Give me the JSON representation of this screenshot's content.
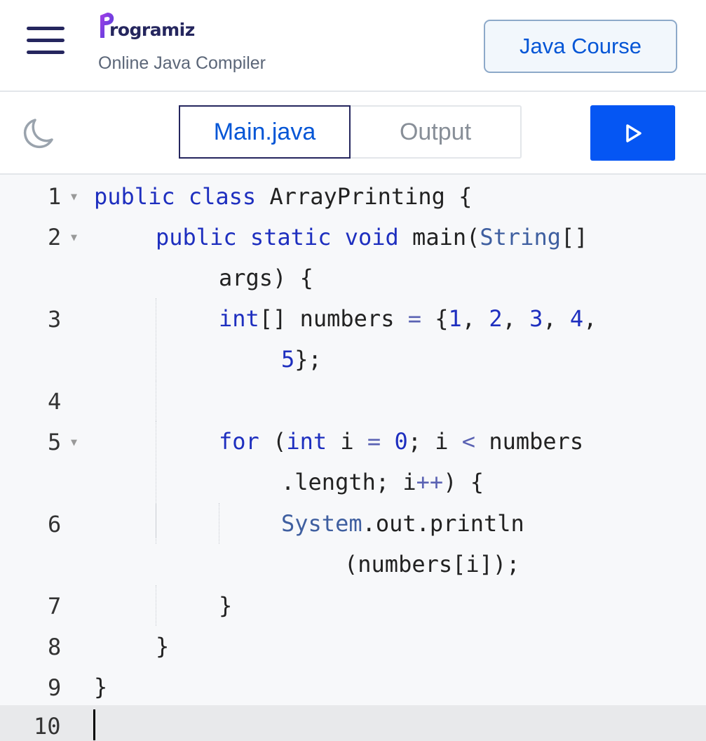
{
  "header": {
    "brand": "Programiz",
    "brand_rest": "rogramiz",
    "subtitle": "Online Java Compiler",
    "course_button": "Java Course",
    "colors": {
      "brand": "#25265e",
      "accent": "#0556d6"
    }
  },
  "toolbar": {
    "theme_icon": "moon-icon",
    "tabs": [
      {
        "label": "Main.java",
        "active": true
      },
      {
        "label": "Output",
        "active": false
      }
    ],
    "run_icon": "play-icon",
    "run_color": "#0556f3"
  },
  "editor": {
    "line_numbers": [
      "1",
      "2",
      "3",
      "4",
      "5",
      "6",
      "7",
      "8",
      "9",
      "10"
    ],
    "foldable_lines": [
      "1",
      "2",
      "5"
    ],
    "lines": [
      "public class ArrayPrinting {",
      "    public static void main(String[] args) {",
      "        int[] numbers = {1, 2, 3, 4, 5};",
      "",
      "        for (int i = 0; i < numbers.length; i++) {",
      "            System.out.println(numbers[i]);",
      "        }",
      "    }",
      "}",
      ""
    ],
    "active_line": "10"
  }
}
